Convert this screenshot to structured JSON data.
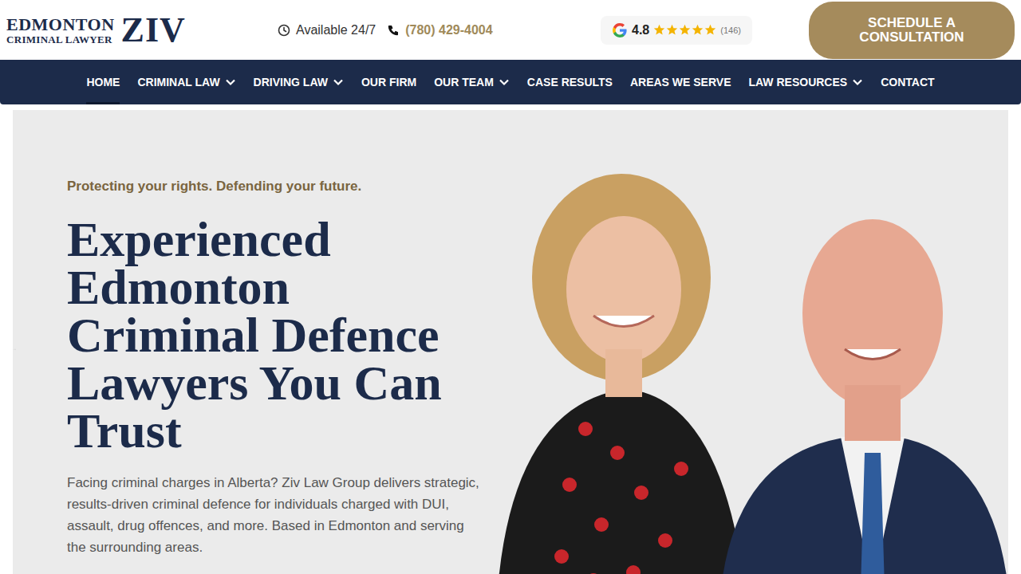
{
  "header": {
    "logo": {
      "line1": "EDMONTON",
      "line2": "CRIMINAL LAWYER",
      "mark": "ZIV"
    },
    "availability": "Available 24/7",
    "phone": "(780) 429-4004",
    "rating": {
      "score": "4.8",
      "stars": 5,
      "count": "(146)"
    },
    "cta": "SCHEDULE A CONSULTATION"
  },
  "nav": [
    {
      "label": "HOME",
      "selected": true,
      "dropdown": false
    },
    {
      "label": "CRIMINAL LAW",
      "selected": false,
      "dropdown": true
    },
    {
      "label": "DRIVING LAW",
      "selected": false,
      "dropdown": true
    },
    {
      "label": "OUR FIRM",
      "selected": false,
      "dropdown": false
    },
    {
      "label": "OUR TEAM",
      "selected": false,
      "dropdown": true
    },
    {
      "label": "CASE RESULTS",
      "selected": false,
      "dropdown": false
    },
    {
      "label": "AREAS WE SERVE",
      "selected": false,
      "dropdown": false
    },
    {
      "label": "LAW RESOURCES",
      "selected": false,
      "dropdown": true
    },
    {
      "label": "CONTACT",
      "selected": false,
      "dropdown": false
    }
  ],
  "hero": {
    "tagline": "Protecting your rights. Defending your future.",
    "heading": [
      "Experienced",
      "Edmonton",
      "Criminal Defence",
      "Lawyers You Can",
      "Trust"
    ],
    "body": "Facing criminal charges in Alberta? Ziv Law Group delivers strategic, results-driven criminal defence for individuals charged with DUI, assault, drug offences, and more. Based in Edmonton and serving the surrounding areas."
  }
}
